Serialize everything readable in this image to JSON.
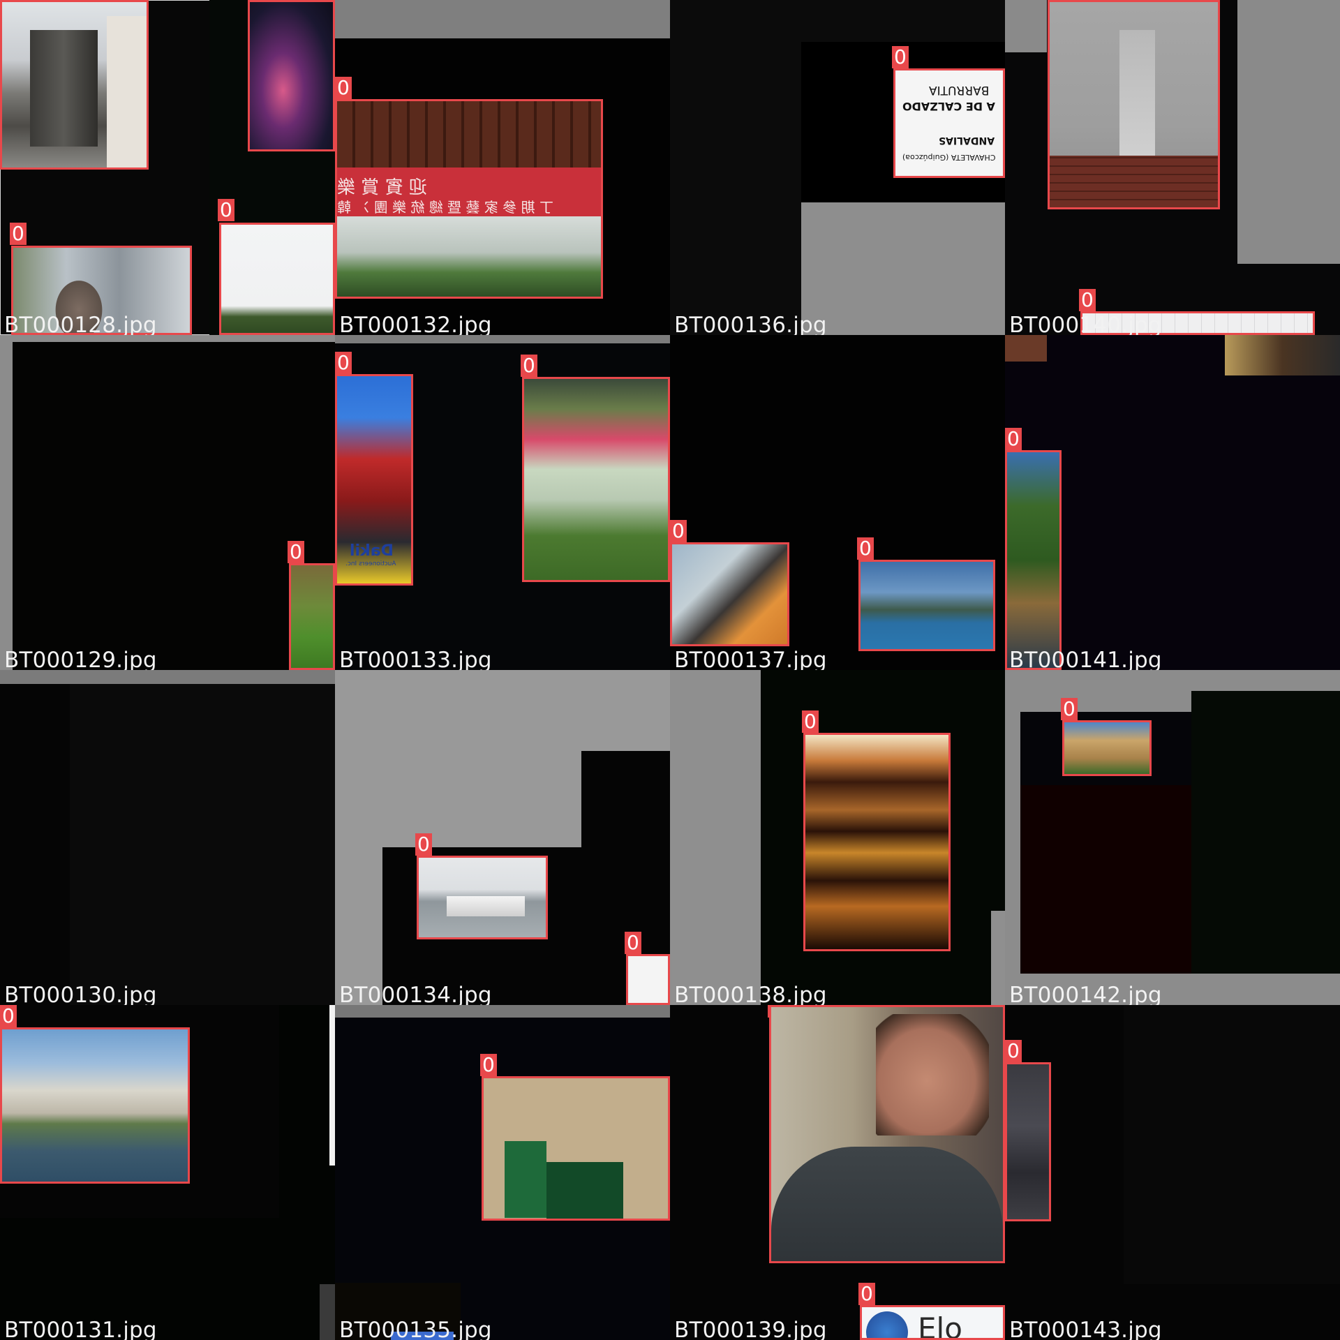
{
  "mosaic": {
    "tiles": [
      {
        "filename": "BT000128.jpg",
        "labels": [
          "0",
          "0",
          "0"
        ]
      },
      {
        "filename": "BT000132.jpg",
        "labels": [
          "0"
        ],
        "sign_text": [
          "迎 賓 賞 樂",
          "丁 期 參 家 藝 暨 總 統 樂 團 冫 韓"
        ]
      },
      {
        "filename": "BT000136.jpg",
        "labels": [
          "0"
        ],
        "sign_text": [
          "BARRUTIA",
          "A DE CALZADO",
          "ANDALIAS",
          "CHAVALETA (Guipúzcoa)"
        ]
      },
      {
        "filename": "BT000140.jpg",
        "labels": [
          "0",
          "0"
        ]
      },
      {
        "filename": "BT000129.jpg",
        "labels": [
          "0"
        ]
      },
      {
        "filename": "BT000133.jpg",
        "labels": [
          "0",
          "0"
        ],
        "sign_text": [
          "Dakil",
          "Auctioneers Inc."
        ]
      },
      {
        "filename": "BT000137.jpg",
        "labels": [
          "0",
          "0"
        ]
      },
      {
        "filename": "BT000141.jpg",
        "labels": [
          "0"
        ]
      },
      {
        "filename": "BT000130.jpg",
        "labels": []
      },
      {
        "filename": "BT000134.jpg",
        "labels": [
          "0",
          "0"
        ]
      },
      {
        "filename": "BT000138.jpg",
        "labels": [
          "0"
        ]
      },
      {
        "filename": "BT000142.jpg",
        "labels": [
          "0"
        ]
      },
      {
        "filename": "BT000131.jpg",
        "labels": [
          "0"
        ]
      },
      {
        "filename": "BT000135.jpg",
        "labels": [
          "0"
        ]
      },
      {
        "filename": "BT000139.jpg",
        "labels": [
          "0",
          "0"
        ],
        "sign_text": [
          "Elo"
        ]
      },
      {
        "filename": "BT000143.jpg",
        "labels": [
          "0"
        ]
      }
    ]
  },
  "colors": {
    "box": "#e8484b",
    "caption_text": "#f2f2f2",
    "tile_background": "#070707",
    "padding_gray": "#8f8f8f"
  }
}
